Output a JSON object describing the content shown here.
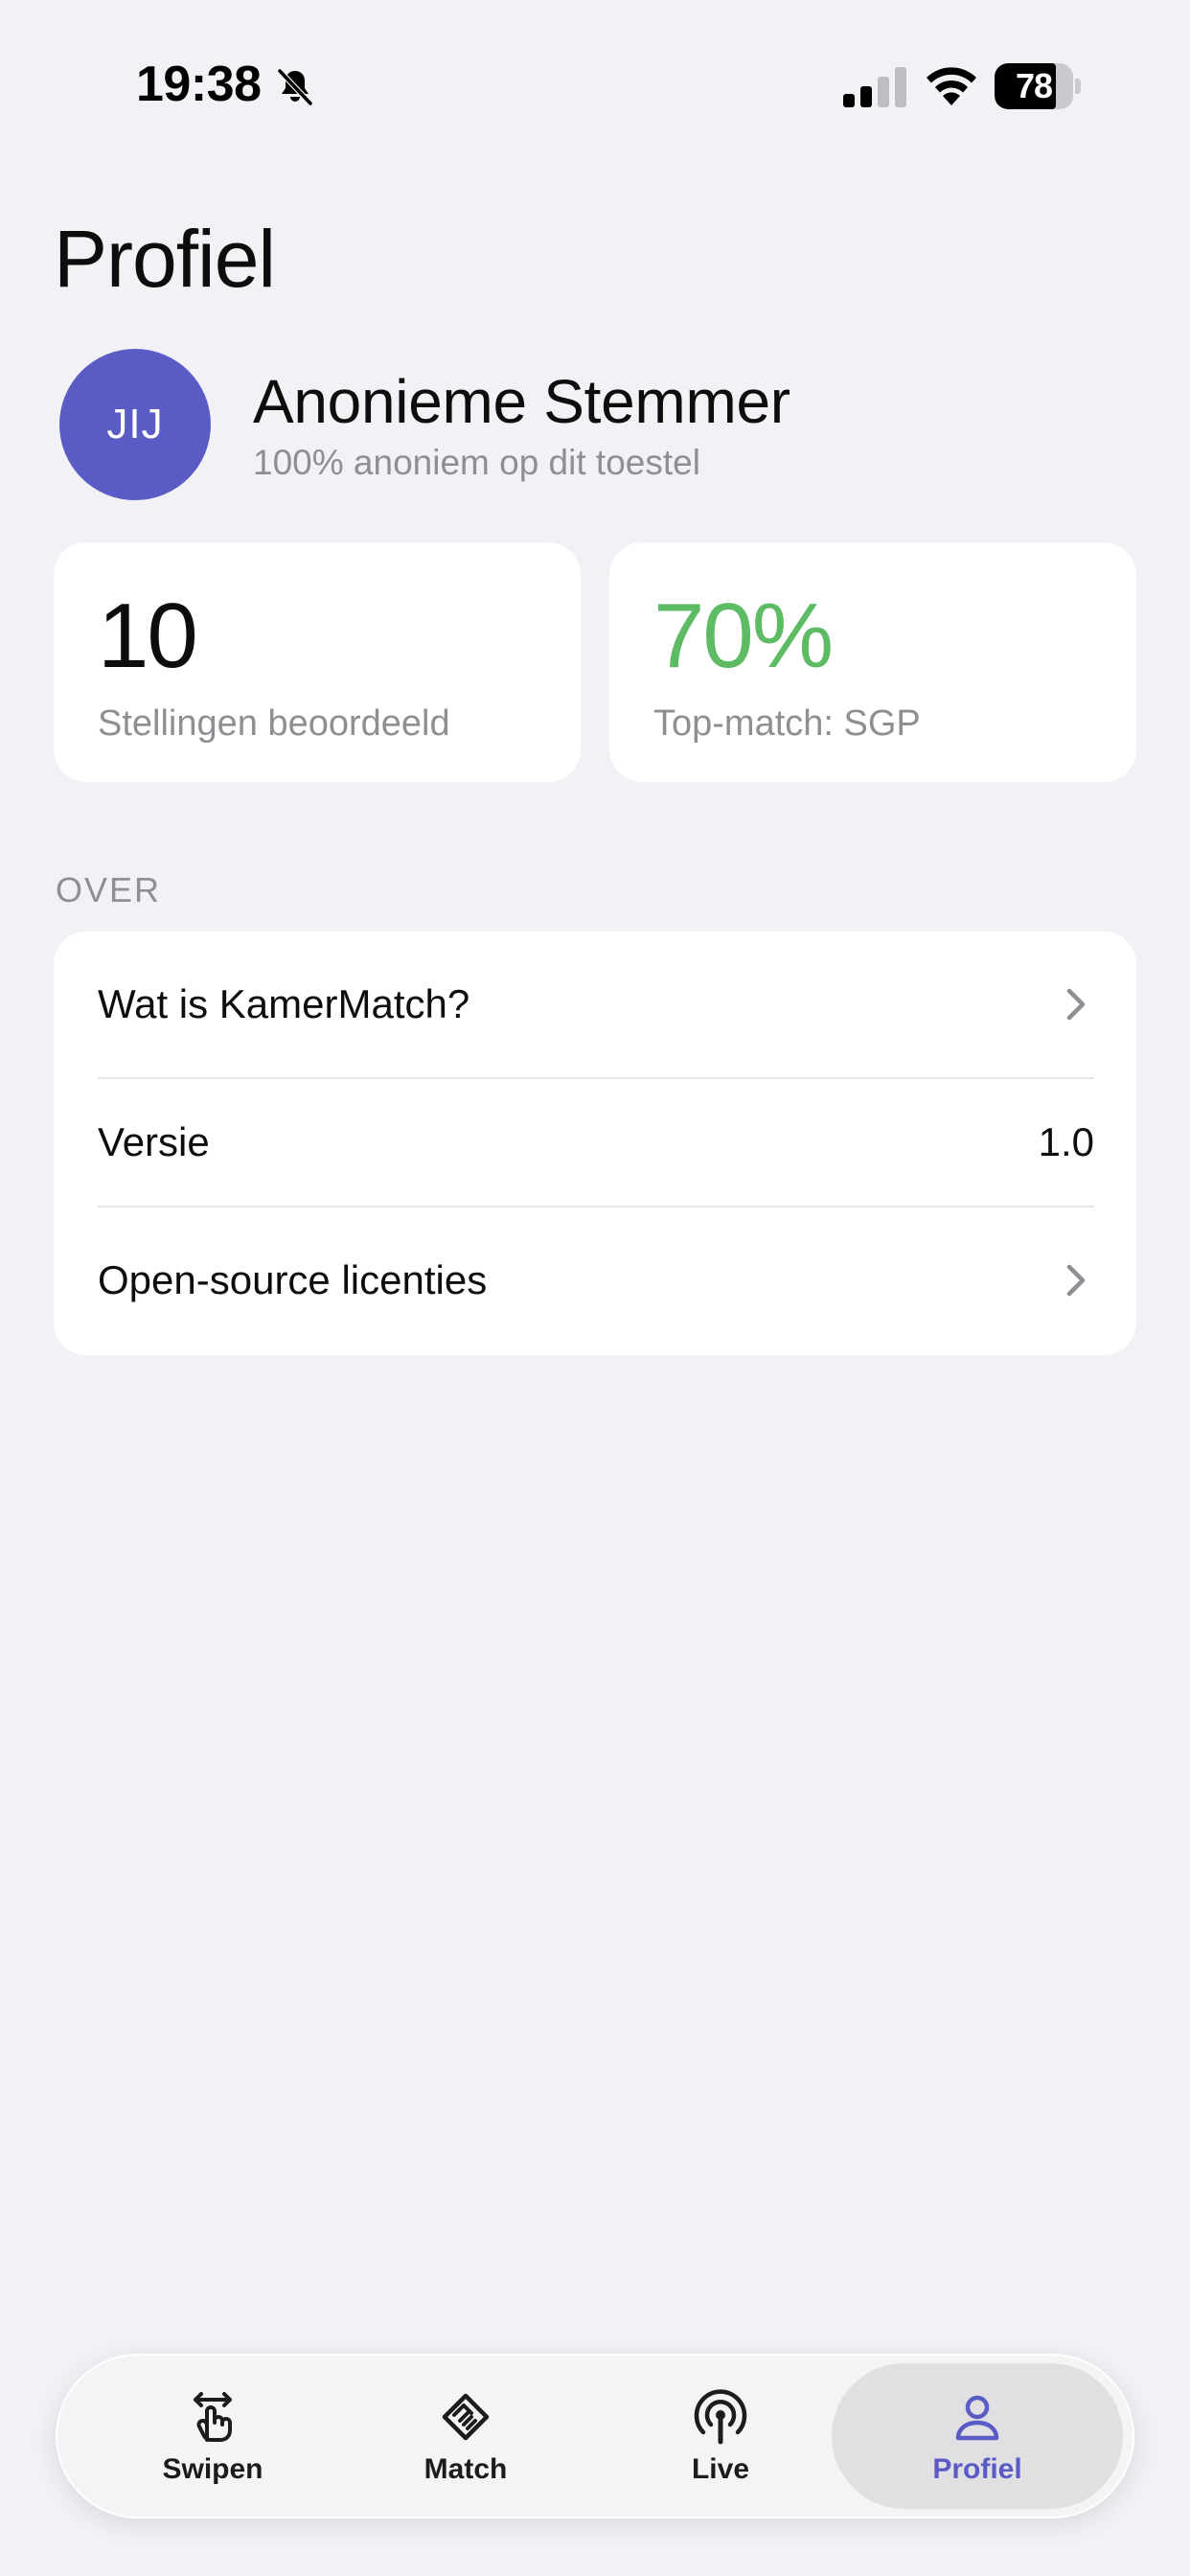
{
  "status_bar": {
    "time": "19:38",
    "battery_percent": "78",
    "battery_level": 0.78,
    "icons": [
      "bell-slash-icon",
      "signal-icon",
      "wifi-icon",
      "battery-icon"
    ]
  },
  "page": {
    "title": "Profiel"
  },
  "profile": {
    "avatar_initials": "JIJ",
    "avatar_color": "#5b5bc6",
    "name": "Anonieme Stemmer",
    "subtitle": "100% anoniem op dit toestel"
  },
  "stats": [
    {
      "value": "10",
      "label": "Stellingen beoordeeld"
    },
    {
      "value": "70%",
      "label": "Top-match: SGP",
      "value_color": "#5dbb63"
    }
  ],
  "section_over": {
    "header": "OVER",
    "items": [
      {
        "label": "Wat is KamerMatch?",
        "icon": "chevron-right-icon"
      },
      {
        "label": "Versie",
        "value": "1.0"
      },
      {
        "label": "Open-source licenties",
        "icon": "chevron-right-icon"
      }
    ]
  },
  "tab_bar": {
    "active_color": "#5b5bc6",
    "tabs": [
      {
        "label": "Swipen",
        "icon": "swipe-hand-icon",
        "active": false
      },
      {
        "label": "Match",
        "icon": "handshake-icon",
        "active": false
      },
      {
        "label": "Live",
        "icon": "broadcast-icon",
        "active": false
      },
      {
        "label": "Profiel",
        "icon": "person-icon",
        "active": true
      }
    ]
  }
}
